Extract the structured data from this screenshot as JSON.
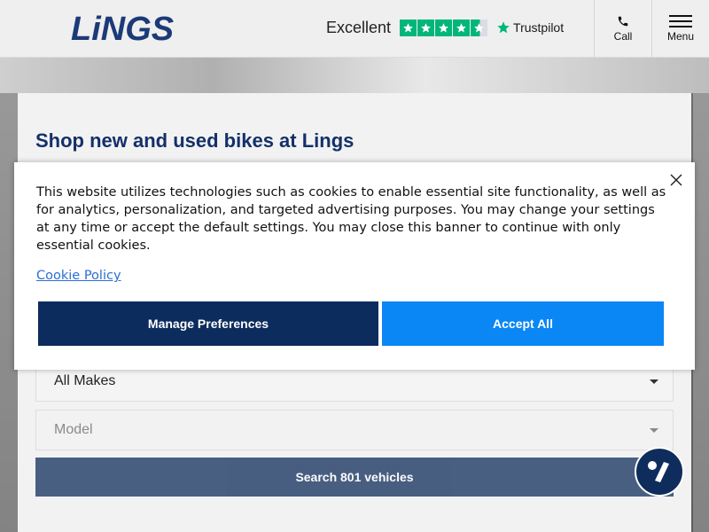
{
  "header": {
    "logo_text": "LiNGS",
    "trustpilot": {
      "rating_word": "Excellent",
      "brand": "Trustpilot",
      "stars": 4.5
    },
    "call_label": "Call",
    "menu_label": "Menu"
  },
  "search_card": {
    "title": "Shop new and used bikes at Lings",
    "make_value": "All Makes",
    "model_placeholder": "Model",
    "search_button": "Search 801 vehicles"
  },
  "cookie_banner": {
    "text": "This website utilizes technologies such as cookies to enable essential site functionality, as well as for analytics, personalization, and targeted advertising purposes. You may change your settings at any time or accept the default settings. You may close this banner to continue with only essential cookies.",
    "policy_link": "Cookie Policy",
    "manage_button": "Manage Preferences",
    "accept_button": "Accept All"
  },
  "colors": {
    "brand_navy": "#0f2d5c",
    "accept_blue": "#0a86f5",
    "trustpilot_green": "#00b67a",
    "link_blue": "#2b6fd6"
  },
  "icons": [
    "phone-icon",
    "hamburger-menu-icon",
    "trustpilot-star-icon",
    "caret-down-icon",
    "close-icon",
    "chat-icon"
  ]
}
